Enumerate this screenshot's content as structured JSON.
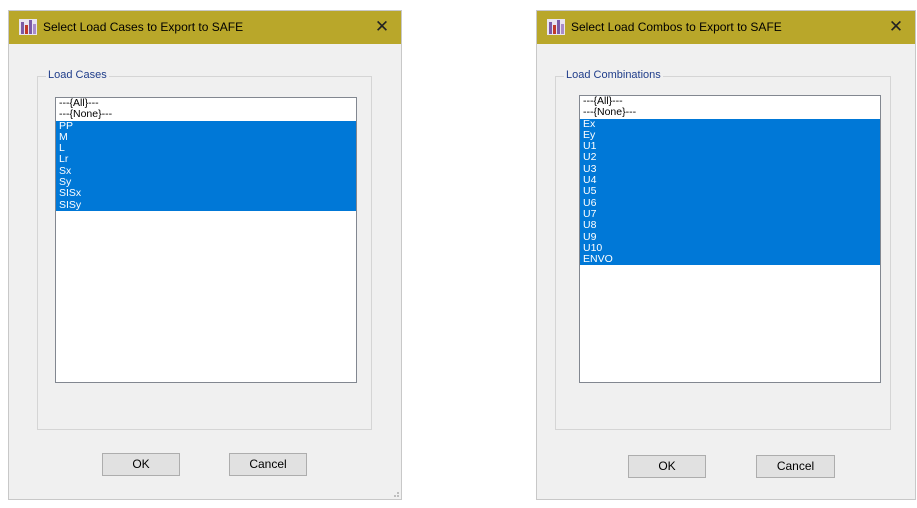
{
  "left_dialog": {
    "title": "Select Load Cases to Export to SAFE",
    "close_glyph": "✕",
    "group_label": "Load Cases",
    "items": [
      {
        "label": "---{All}---",
        "selected": false
      },
      {
        "label": "---{None}---",
        "selected": false
      },
      {
        "label": "PP",
        "selected": true
      },
      {
        "label": "M",
        "selected": true
      },
      {
        "label": "L",
        "selected": true
      },
      {
        "label": "Lr",
        "selected": true
      },
      {
        "label": "Sx",
        "selected": true
      },
      {
        "label": "Sy",
        "selected": true
      },
      {
        "label": "SISx",
        "selected": true
      },
      {
        "label": "SISy",
        "selected": true
      }
    ],
    "ok_label": "OK",
    "cancel_label": "Cancel"
  },
  "right_dialog": {
    "title": "Select Load Combos to Export to SAFE",
    "close_glyph": "✕",
    "group_label": "Load Combinations",
    "items": [
      {
        "label": "---{All}---",
        "selected": false
      },
      {
        "label": "---{None}---",
        "selected": false
      },
      {
        "label": "Ex",
        "selected": true
      },
      {
        "label": "Ey",
        "selected": true
      },
      {
        "label": "U1",
        "selected": true
      },
      {
        "label": "U2",
        "selected": true
      },
      {
        "label": "U3",
        "selected": true
      },
      {
        "label": "U4",
        "selected": true
      },
      {
        "label": "U5",
        "selected": true
      },
      {
        "label": "U6",
        "selected": true
      },
      {
        "label": "U7",
        "selected": true
      },
      {
        "label": "U8",
        "selected": true
      },
      {
        "label": "U9",
        "selected": true
      },
      {
        "label": "U10",
        "selected": true
      },
      {
        "label": "ENVO",
        "selected": true
      }
    ],
    "ok_label": "OK",
    "cancel_label": "Cancel"
  },
  "colors": {
    "titlebar": "#b9a72a",
    "selection": "#0078d7",
    "group_label": "#1f3d8a"
  },
  "icons": {
    "app": "etabs-app-icon",
    "close": "close-icon"
  }
}
